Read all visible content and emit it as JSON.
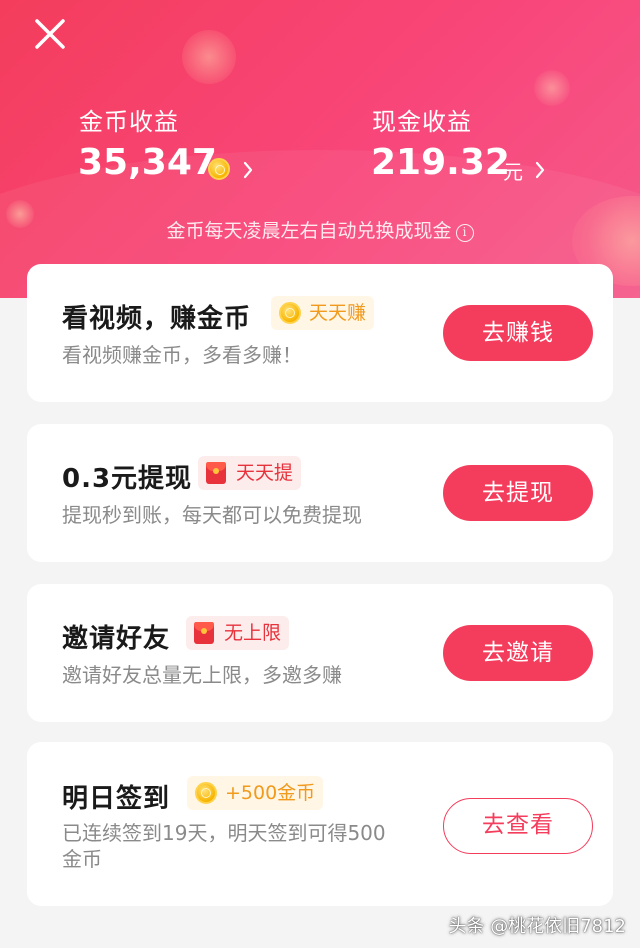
{
  "header": {
    "coin_label": "金币收益",
    "coin_value": "35,347",
    "cash_label": "现金收益",
    "cash_value": "219.32",
    "cash_unit": "元",
    "hint": "金币每天凌晨左右自动兑换成现金",
    "info_glyph": "i",
    "accent": "#f43d5c"
  },
  "cards": [
    {
      "title": "看视频，赚金币",
      "badge": "天天赚",
      "badge_icon": "coin-icon",
      "desc": "看视频赚金币，多看多赚！",
      "button": "去赚钱"
    },
    {
      "title": "0.3元提现",
      "badge": "天天提",
      "badge_icon": "red-envelope-icon",
      "desc": "提现秒到账，每天都可以免费提现",
      "button": "去提现"
    },
    {
      "title": "邀请好友",
      "badge": "无上限",
      "badge_icon": "red-envelope-icon",
      "desc": "邀请好友总量无上限，多邀多赚",
      "button": "去邀请"
    },
    {
      "title": "明日签到",
      "badge": "+500金币",
      "badge_icon": "coin-icon",
      "desc_line1": "已连续签到19天，明天签到可得500",
      "desc_line2": "金币",
      "button": "去查看"
    }
  ],
  "watermark": "头条 @桃花依旧7812"
}
